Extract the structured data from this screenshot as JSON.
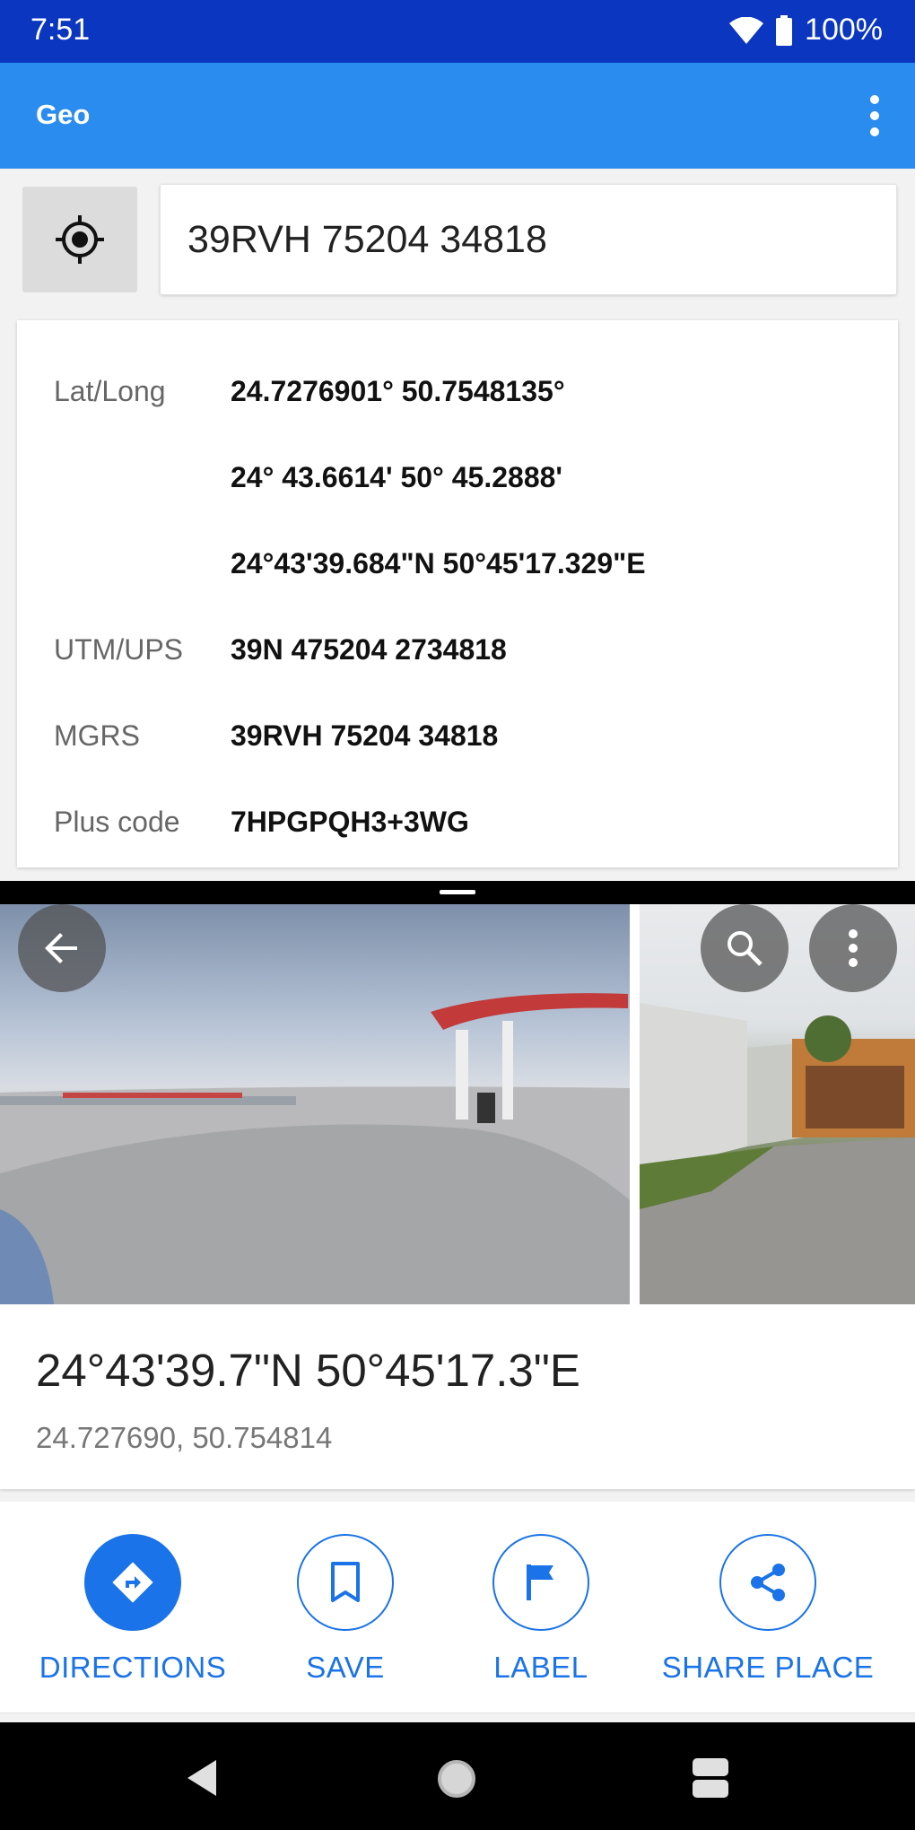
{
  "status_bar": {
    "time": "7:51",
    "battery": "100%",
    "icons": [
      "wifi-icon",
      "battery-icon"
    ]
  },
  "app_bar": {
    "title": "Geo",
    "menu_icon": "more-vert-icon"
  },
  "search": {
    "locate_icon": "my-location-icon",
    "value": "39RVH 75204 34818"
  },
  "coordinates": {
    "rows": [
      {
        "label": "Lat/Long",
        "value": "24.7276901° 50.7548135°"
      },
      {
        "label": "",
        "value": "24° 43.6614' 50° 45.2888'"
      },
      {
        "label": "",
        "value": "24°43'39.684\"N 50°45'17.329\"E"
      },
      {
        "label": "UTM/UPS",
        "value": "39N 475204 2734818"
      },
      {
        "label": "MGRS",
        "value": "39RVH 75204 34818"
      },
      {
        "label": "Plus code",
        "value": "7HPGPQH3+3WG"
      }
    ]
  },
  "maps_sheet": {
    "back_icon": "arrow-back-icon",
    "search_icon": "search-icon",
    "more_icon": "more-vert-icon",
    "place_title": "24°43'39.7\"N 50°45'17.3\"E",
    "place_subtitle": "24.727690, 50.754814",
    "actions": [
      {
        "label": "DIRECTIONS",
        "icon": "directions-icon"
      },
      {
        "label": "SAVE",
        "icon": "bookmark-icon"
      },
      {
        "label": "LABEL",
        "icon": "flag-icon"
      },
      {
        "label": "SHARE PLACE",
        "icon": "share-icon"
      }
    ]
  },
  "colors": {
    "status_bar": "#0a36c0",
    "app_bar": "#2b8cf0",
    "accent": "#1a73e8"
  },
  "nav_bar": {
    "icons": [
      "back-nav-icon",
      "home-nav-icon",
      "recents-nav-icon"
    ]
  }
}
